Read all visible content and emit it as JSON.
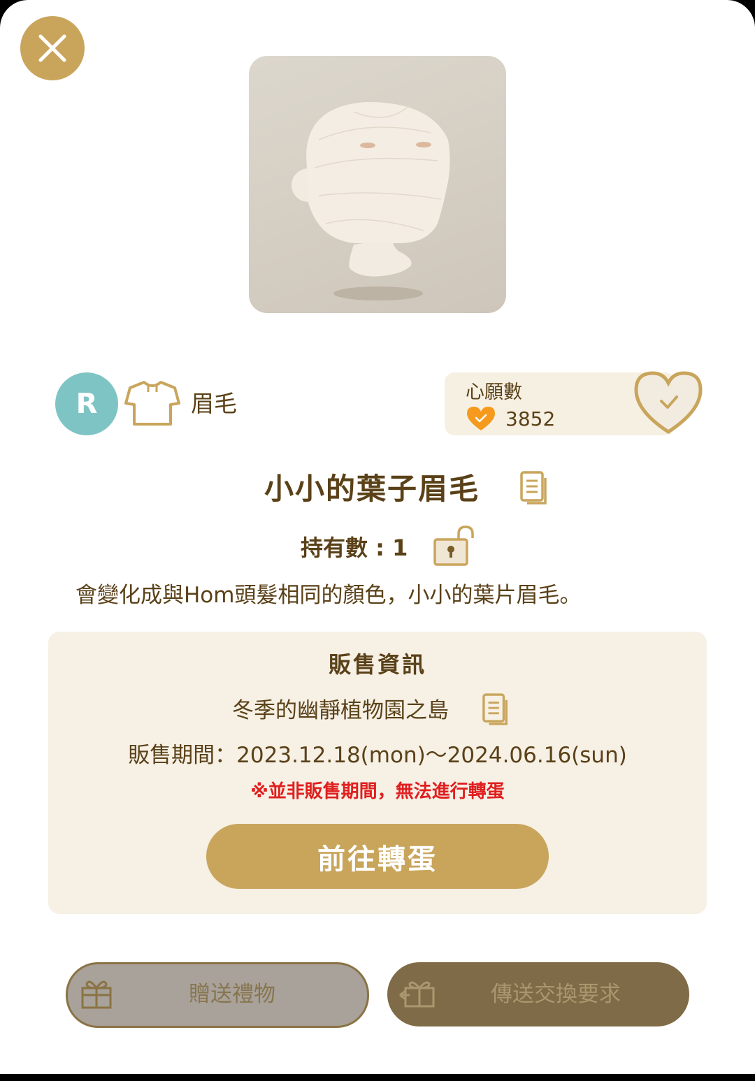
{
  "header": {
    "close_icon": "close-x-icon"
  },
  "item": {
    "preview_alt": "eyebrow item preview",
    "rarity": "R",
    "category_icon": "shirt-icon",
    "category": "眉毛",
    "name": "小小的葉子眉毛",
    "owned_label": "持有數",
    "owned_separator": ":",
    "owned_count": "1",
    "description": "會變化成與Hom頭髮相同的顏色，小小的葉片眉毛。"
  },
  "wishlist": {
    "label": "心願數",
    "count": "3852",
    "heart_icon": "heart-check-icon"
  },
  "sale": {
    "title": "販售資訊",
    "island": "冬季的幽靜植物園之島",
    "period": "販售期間：2023.12.18(mon)～2024.06.16(sun)",
    "warning": "※並非販售期間，無法進行轉蛋",
    "gacha_button": "前往轉蛋"
  },
  "actions": {
    "gift_label": "贈送禮物",
    "trade_label": "傳送交換要求"
  },
  "colors": {
    "accent_gold": "#c9a55c",
    "text_brown": "#5a4118",
    "rarity_teal": "#7fc4c4",
    "warning_red": "#e01f1f",
    "panel_beige": "#f6f0e5"
  }
}
